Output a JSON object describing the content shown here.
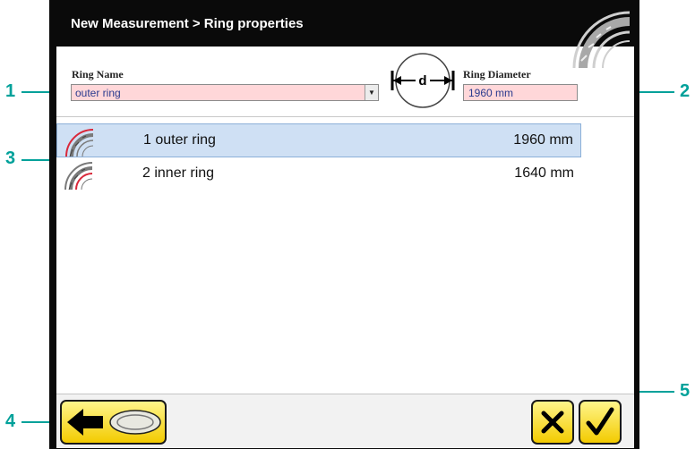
{
  "window": {
    "title": "New Measurement > Ring properties",
    "title_icon": "ring-segment-icon"
  },
  "form": {
    "ring_name_label": "Ring Name",
    "ring_name_value": "outer ring",
    "ring_diameter_label": "Ring Diameter",
    "ring_diameter_value": "1960 mm",
    "diameter_symbol_text": "d"
  },
  "rings": [
    {
      "name": "1 outer ring",
      "diameter": "1960 mm",
      "selected": true,
      "highlight": "outer"
    },
    {
      "name": "2 inner ring",
      "diameter": "1640 mm",
      "selected": false,
      "highlight": "inner"
    }
  ],
  "buttons": {
    "back_icon": "arrow-left-icon",
    "ring_icon": "ring-icon",
    "cancel_icon": "close-icon",
    "confirm_icon": "checkmark-icon"
  },
  "callouts": [
    "1",
    "2",
    "3",
    "4",
    "5"
  ],
  "colors": {
    "callout": "#00a19a",
    "field_bg": "#ffd7d9",
    "field_text": "#2a3b8f",
    "selection": "#cfe0f4",
    "button_yellow": "#f3cb00"
  }
}
